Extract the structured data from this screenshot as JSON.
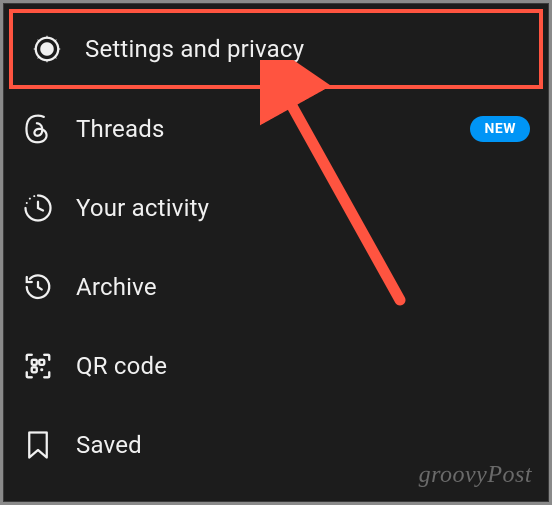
{
  "menu": {
    "items": [
      {
        "label": "Settings and privacy",
        "icon": "gear-icon",
        "highlighted": true
      },
      {
        "label": "Threads",
        "icon": "threads-icon",
        "badge": "NEW"
      },
      {
        "label": "Your activity",
        "icon": "clock-activity-icon"
      },
      {
        "label": "Archive",
        "icon": "archive-icon"
      },
      {
        "label": "QR code",
        "icon": "qr-code-icon"
      },
      {
        "label": "Saved",
        "icon": "bookmark-icon"
      }
    ]
  },
  "watermark": "groovyPost",
  "annotation": {
    "type": "arrow",
    "color": "#ff5440"
  }
}
